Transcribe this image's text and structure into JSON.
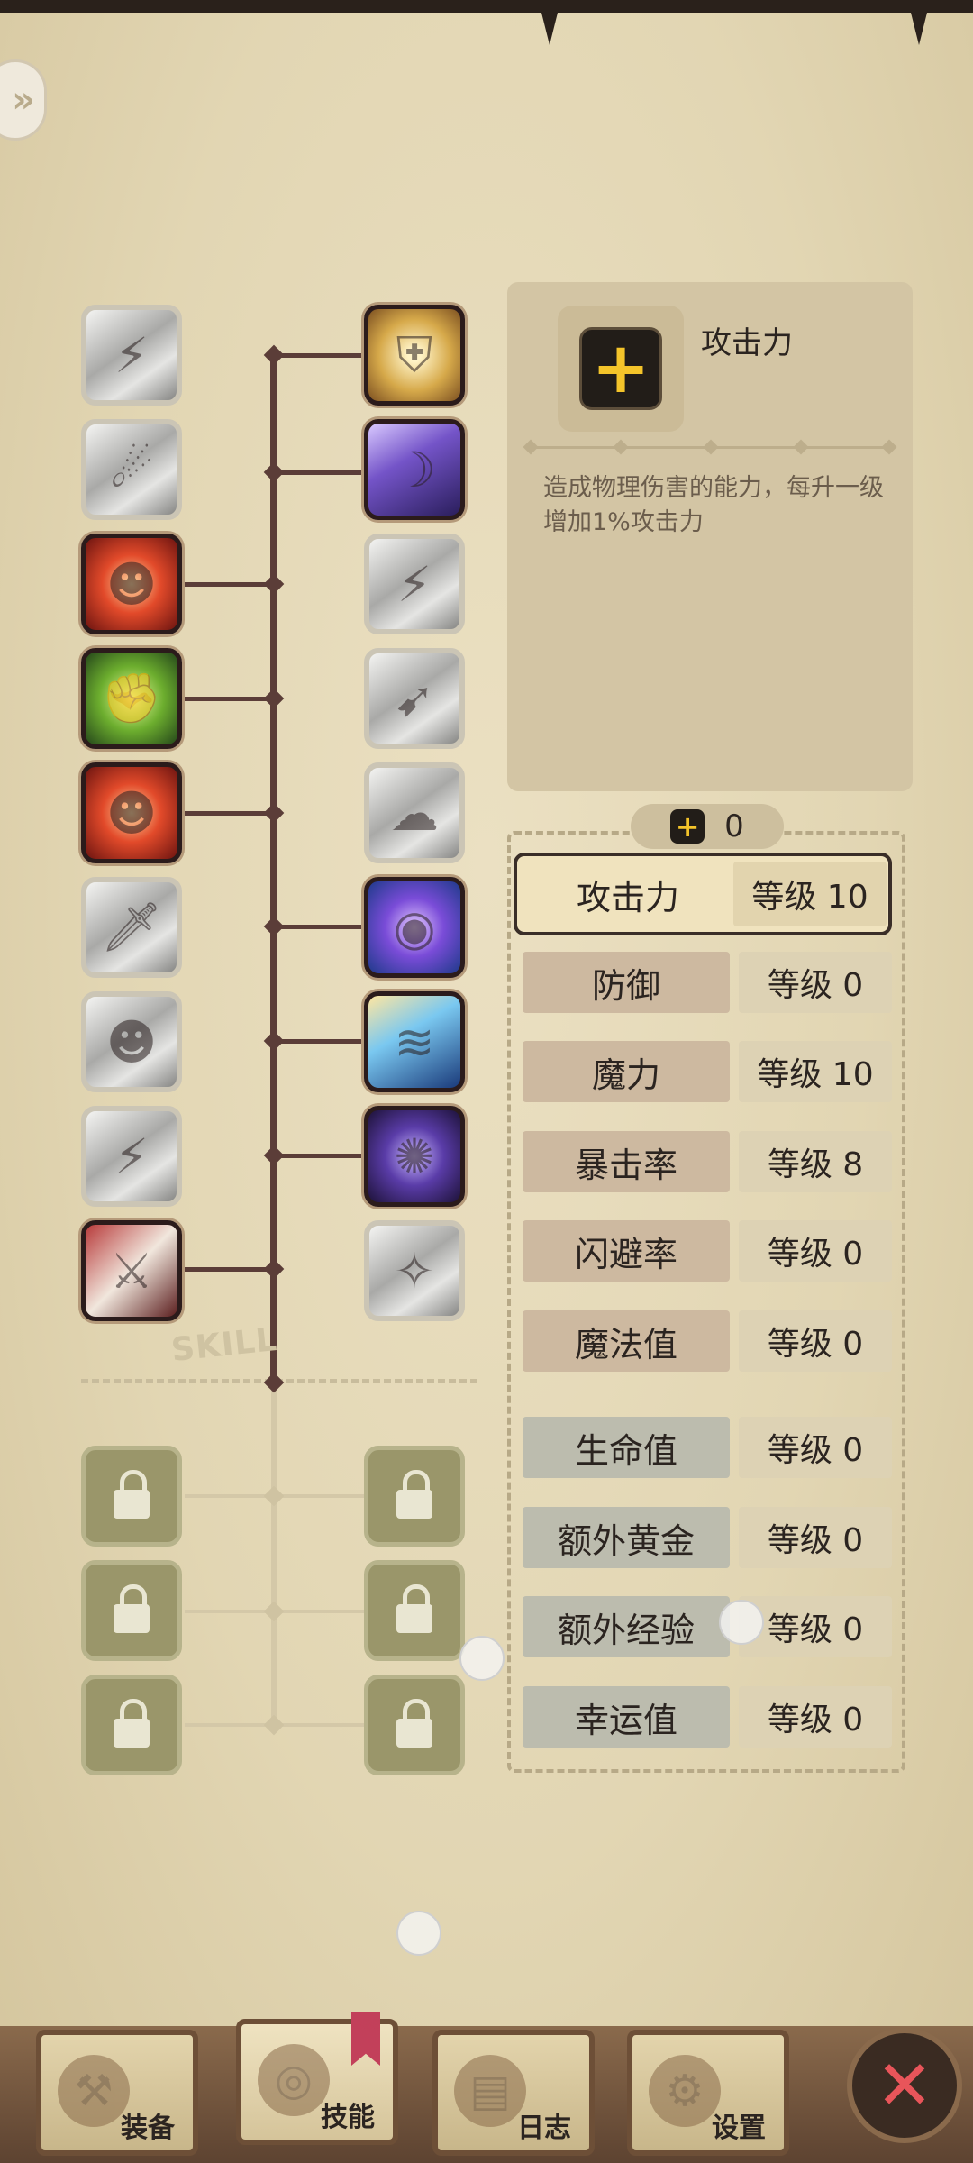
{
  "detail": {
    "title": "攻击力",
    "description": "造成物理伤害的能力，每升一级增加1%攻击力"
  },
  "points": {
    "plus_icon": "+",
    "value": "0"
  },
  "tree_label": "SKILL",
  "stats": [
    {
      "name": "攻击力",
      "level": "等级 10",
      "selected": true
    },
    {
      "name": "防御",
      "level": "等级 0"
    },
    {
      "name": "魔力",
      "level": "等级 10"
    },
    {
      "name": "暴击率",
      "level": "等级 8"
    },
    {
      "name": "闪避率",
      "level": "等级 0"
    },
    {
      "name": "魔法值",
      "level": "等级 0"
    },
    {
      "name": "生命值",
      "level": "等级 0"
    },
    {
      "name": "额外黄金",
      "level": "等级 0"
    },
    {
      "name": "额外经验",
      "level": "等级 0"
    },
    {
      "name": "幸运值",
      "level": "等级 0"
    }
  ],
  "nav": {
    "equipment": "装备",
    "skills": "技能",
    "log": "日志",
    "settings": "设置"
  }
}
